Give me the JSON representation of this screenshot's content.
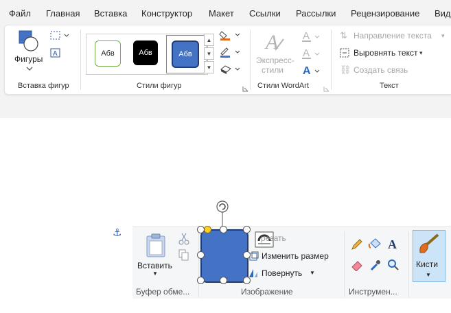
{
  "tabs": [
    "Файл",
    "Главная",
    "Вставка",
    "Конструктор",
    "Макет",
    "Ссылки",
    "Рассылки",
    "Рецензирование",
    "Вид"
  ],
  "insert_shapes": {
    "shapes_label": "Фигуры",
    "group_label": "Вставка фигур"
  },
  "shape_styles": {
    "swatches": [
      "Абв",
      "Абв",
      "Абв"
    ],
    "group_label": "Стили фигур"
  },
  "wordart": {
    "express_styles_label": "Экспресс-\nстили",
    "express_line1": "Экспресс-",
    "express_line2": "стили",
    "group_label": "Стили WordArt"
  },
  "text_group": {
    "direction_label": "Направление текста",
    "align_label": "Выровнять текст",
    "link_label": "Создать связь",
    "group_label": "Текст"
  },
  "paint": {
    "paste_label": "Вставить",
    "clipboard_label": "Буфер обме...",
    "crop_label": "Обрезать",
    "crop_visible": "резать",
    "resize_label": "Изменить размер",
    "rotate_label": "Повернуть",
    "image_label": "Изображение",
    "tools_label": "Инструмен...",
    "brushes_label": "Кисти"
  },
  "colors": {
    "accent": "#4472c4",
    "accent_dark": "#1f3d73",
    "anchor": "#2a6bc1",
    "orange": "#e06c1f"
  }
}
